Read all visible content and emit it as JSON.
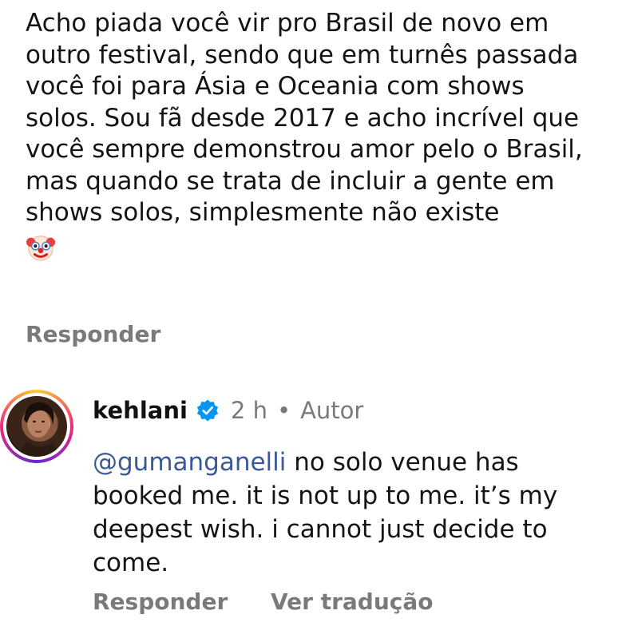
{
  "comment": {
    "text": "Acho piada você vir pro Brasil de novo em outro festival, sendo que em turnês passada você foi para Ásia e Oceania com shows solos. Sou fã desde 2017 e acho incrível que você sempre demonstrou amor pelo o Brasil, mas quando se trata de incluir a gente em shows solos, simplesmente não existe",
    "emoji": "clown-face-emoji",
    "reply_label": "Responder"
  },
  "reply": {
    "username": "kehlani",
    "verified_icon": "verified-badge-icon",
    "time": "2 h",
    "separator": "•",
    "author_label": "Autor",
    "mention": "@gumanganelli",
    "text": " no solo venue has booked me. it is not up to me. it’s my deepest wish. i cannot just decide to come.",
    "reply_label": "Responder",
    "translate_label": "Ver tradução"
  },
  "colors": {
    "text": "#141414",
    "muted": "#7a7a7a",
    "mention": "#3b5998",
    "verified": "#0095f6"
  }
}
